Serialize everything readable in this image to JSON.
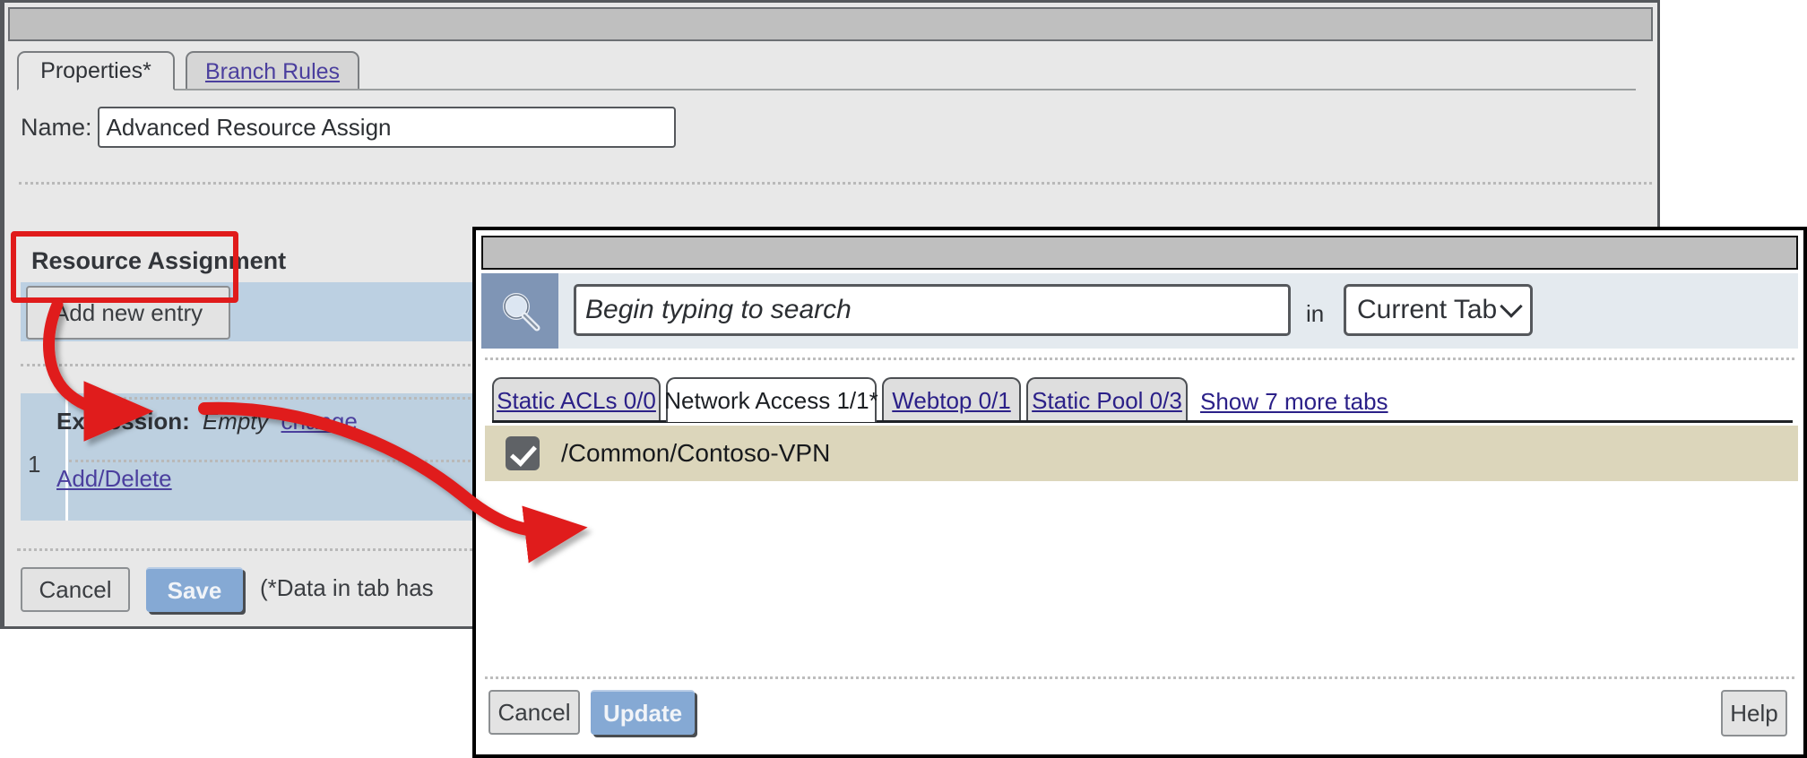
{
  "window1": {
    "title": "",
    "tabs": [
      {
        "label": "Properties*",
        "active": true
      },
      {
        "label": "Branch Rules",
        "active": false
      }
    ],
    "name_field": {
      "label": "Name:",
      "value": "Advanced Resource Assign",
      "placeholder": ""
    },
    "section": {
      "title": "Resource Assignment"
    },
    "add_new_entry_label": "Add new entry",
    "entry": {
      "index": "1",
      "expression_label": "Expression:",
      "expression_value": "Empty",
      "change_link": "change",
      "add_delete_link": "Add/Delete"
    },
    "footer": {
      "cancel_label": "Cancel",
      "save_label": "Save",
      "note": "(*Data in tab has"
    }
  },
  "window2": {
    "title": "",
    "search": {
      "icon": "search-icon",
      "placeholder": "Begin typing to search",
      "value": "",
      "in_label": "in",
      "scope_value": "Current Tab"
    },
    "tabs": [
      {
        "label": "Static ACLs 0/0",
        "active": false
      },
      {
        "label": "Network Access 1/1*",
        "active": true
      },
      {
        "label": "Webtop 0/1",
        "active": false
      },
      {
        "label": "Static Pool 0/3",
        "active": false
      }
    ],
    "show_more_tabs": "Show 7 more tabs",
    "results": [
      {
        "label": "/Common/Contoso-VPN",
        "checked": true
      }
    ],
    "footer": {
      "cancel_label": "Cancel",
      "update_label": "Update",
      "help_label": "Help"
    }
  },
  "annotations": {
    "highlight_color": "#e01b1b",
    "callouts": [
      {
        "from": "add-new-entry-button",
        "to": "add-delete-link"
      },
      {
        "from": "add-delete-link",
        "to": "result-checkbox"
      }
    ]
  },
  "colors": {
    "accent_blue": "#85a9d4",
    "row_blue": "#bcd0e2",
    "result_row": "#dcd6bb",
    "link": "#4b3f9e",
    "annotation_red": "#e01b1b"
  }
}
